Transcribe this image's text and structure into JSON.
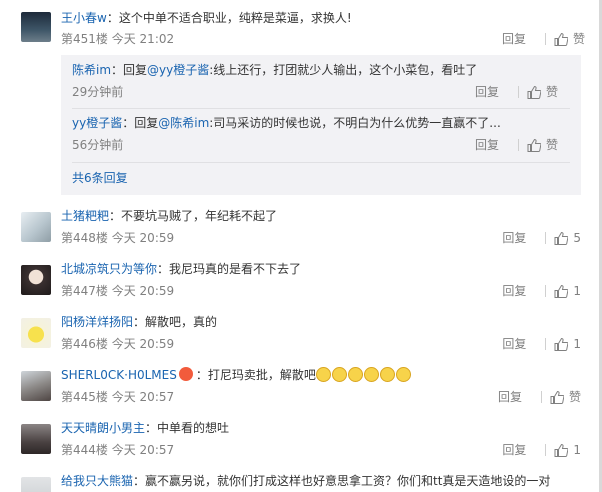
{
  "comments": [
    {
      "user": "王小春w",
      "text": "：这个中单不适合职业，纯粹是菜逼，求换人!",
      "floor": "第451楼",
      "time": "今天 21:02",
      "reply": "回复",
      "likes": "赞",
      "replies": [
        {
          "user": "陈希im",
          "pre": "：回复",
          "mention": "@yy橙子酱",
          "text": ":线上还行，打团就少人输出，这个小菜包，看吐了",
          "time": "29分钟前",
          "reply": "回复",
          "likes": "赞"
        },
        {
          "user": "yy橙子酱",
          "pre": "：回复",
          "mention": "@陈希im",
          "text": ":司马采访的时候也说，不明白为什么优势一直赢不了...",
          "time": "56分钟前",
          "reply": "回复",
          "likes": "赞"
        }
      ],
      "more": "共6条回复"
    },
    {
      "user": "土猪粑粑",
      "text": "：不要坑马贼了，年纪耗不起了",
      "floor": "第448楼",
      "time": "今天 20:59",
      "reply": "回复",
      "likes": "5"
    },
    {
      "user": "北城凉筑只为等你",
      "text": "：我尼玛真的是看不下去了",
      "floor": "第447楼",
      "time": "今天 20:59",
      "reply": "回复",
      "likes": "1"
    },
    {
      "user": "阳杨洋烊扬阳",
      "text": "：解散吧，真的",
      "floor": "第446楼",
      "time": "今天 20:59",
      "reply": "回复",
      "likes": "1"
    },
    {
      "user": "SHERL0CK·H0LMES",
      "text": "：打尼玛卖批，解散吧",
      "floor": "第445楼",
      "time": "今天 20:57",
      "reply": "回复",
      "likes": "赞"
    },
    {
      "user": "天天晴朗小男主",
      "text": "：中单看的想吐",
      "floor": "第444楼",
      "time": "今天 20:57",
      "reply": "回复",
      "likes": "1"
    },
    {
      "user": "给我只大熊猫",
      "text": "：赢不赢另说，就你们打成这样也好意思拿工资？你们和tt真是天造地设的一对"
    }
  ],
  "icons": {
    "like": "thumbs-up-icon",
    "badge": "vip-badge-icon",
    "emoji": "smiley-emoji-icon"
  }
}
